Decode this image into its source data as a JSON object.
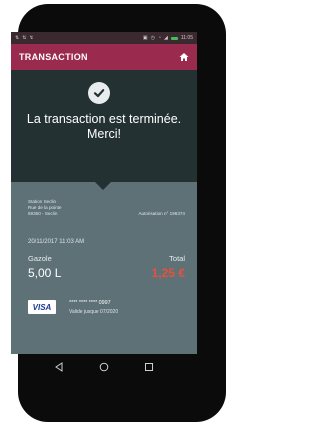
{
  "statusbar": {
    "left_icons": [
      "signal-icon",
      "signal-icon",
      "notification-icon"
    ],
    "right_icons": [
      "nfc-icon",
      "alarm-icon",
      "wifi-icon",
      "signal-strength-icon",
      "battery-icon"
    ],
    "time": "11:05"
  },
  "appbar": {
    "title": "TRANSACTION",
    "home_icon": "home-icon"
  },
  "hero": {
    "status_icon": "check-icon",
    "message_line1": "La transaction est terminée.",
    "message_line2": "Merci!"
  },
  "receipt": {
    "station_line1": "Station Seclin",
    "station_line2": "Rue de la pointe",
    "station_line3": "59350 - Seclin",
    "authorisation": "Autorisation n° 196374",
    "datetime": "20/11/2017 11:03 AM",
    "fuel_label": "Gazole",
    "fuel_quantity": "5,00 L",
    "total_label": "Total",
    "total_amount": "1,25 €",
    "card_brand": "VISA",
    "card_number": "**** **** **** 0997",
    "card_validity": "Valide jusque 07/2020"
  },
  "colors": {
    "appbar": "#9a2a4e",
    "hero": "#243133",
    "receipt": "#5d7177",
    "total": "#e8513c"
  },
  "navbar": {
    "back_icon": "back-icon",
    "home_icon": "home-circle-icon",
    "recents_icon": "recents-icon"
  }
}
